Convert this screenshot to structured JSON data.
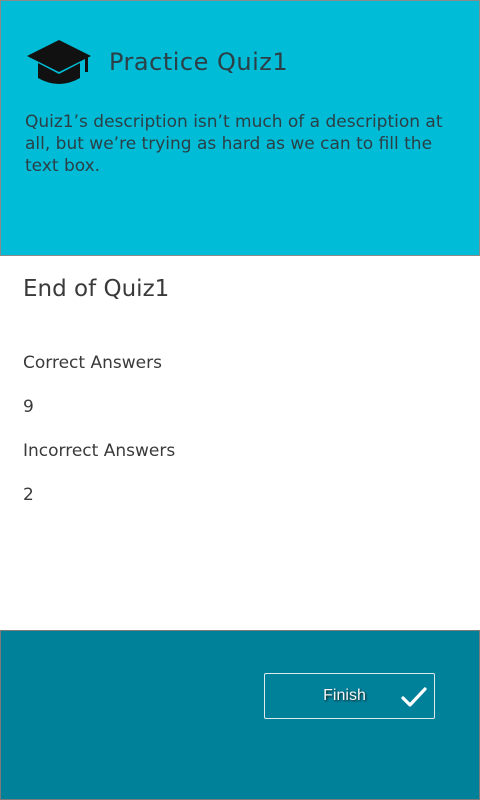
{
  "header": {
    "title": "Practice Quiz1",
    "description": "Quiz1’s description isn’t much of a description at all, but we’re trying as hard as we can to fill the text box.",
    "logo_icon": "graduation-cap-icon"
  },
  "results": {
    "title": "End of Quiz1",
    "correct_label": "Correct Answers",
    "correct_value": "9",
    "incorrect_label": "Incorrect Answers",
    "incorrect_value": "2"
  },
  "footer": {
    "finish_label": "Finish",
    "finish_icon": "checkmark-icon"
  },
  "colors": {
    "header_bg": "#00bcd6",
    "footer_bg": "#00819a",
    "text": "#3a3a3a"
  }
}
